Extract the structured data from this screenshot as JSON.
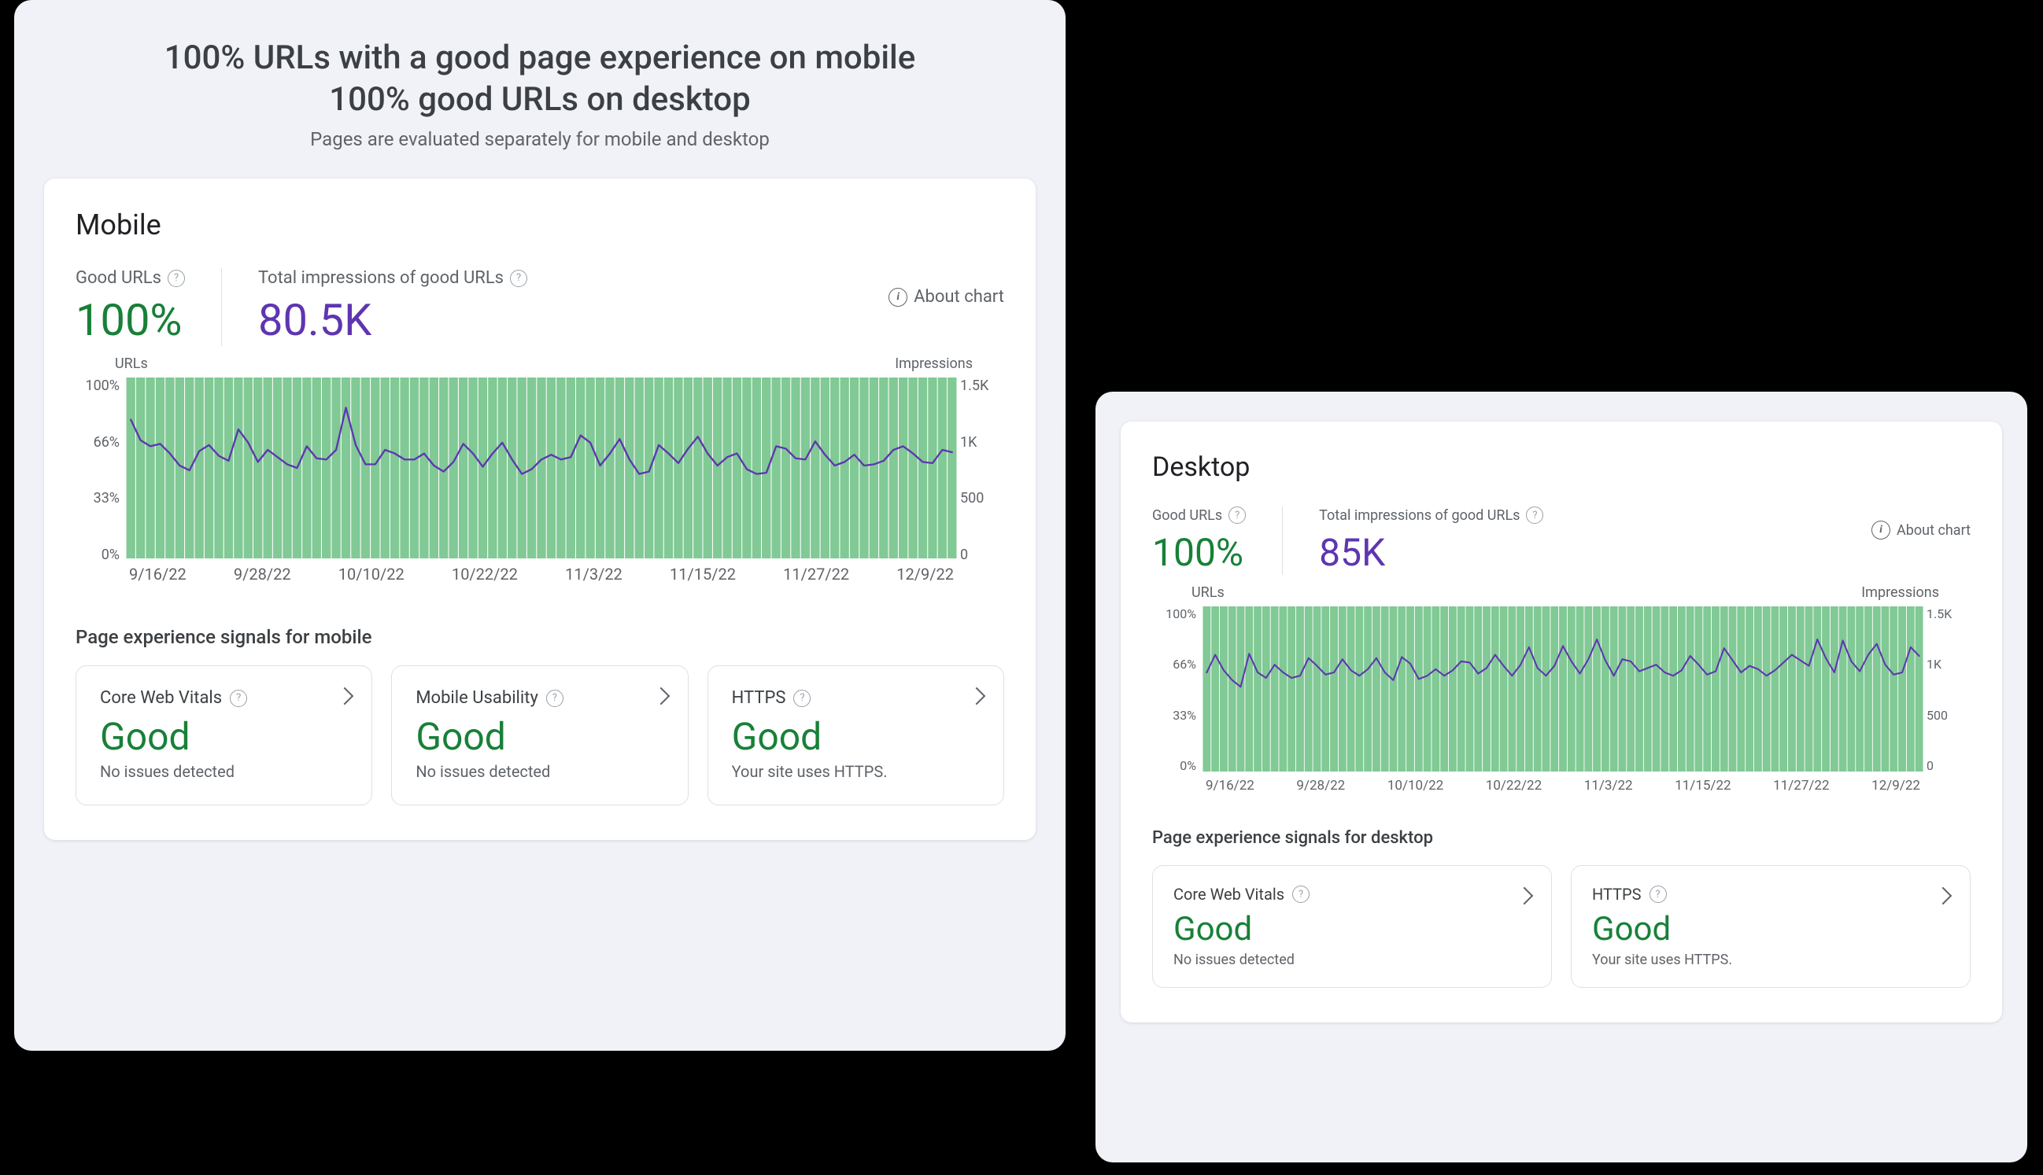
{
  "header": {
    "line1": "100% URLs with a good page experience on mobile",
    "line2": "100% good URLs on desktop",
    "sub": "Pages are evaluated separately for mobile and desktop"
  },
  "about_chart_label": "About chart",
  "mobile": {
    "title": "Mobile",
    "good_urls_label": "Good URLs",
    "good_urls_value": "100%",
    "impr_label": "Total impressions of good URLs",
    "impr_value": "80.5K",
    "signals_title": "Page experience signals for mobile",
    "signals": [
      {
        "name": "Core Web Vitals",
        "status": "Good",
        "sub": "No issues detected"
      },
      {
        "name": "Mobile Usability",
        "status": "Good",
        "sub": "No issues detected"
      },
      {
        "name": "HTTPS",
        "status": "Good",
        "sub": "Your site uses HTTPS."
      }
    ]
  },
  "desktop": {
    "title": "Desktop",
    "good_urls_label": "Good URLs",
    "good_urls_value": "100%",
    "impr_label": "Total impressions of good URLs",
    "impr_value": "85K",
    "signals_title": "Page experience signals for desktop",
    "signals": [
      {
        "name": "Core Web Vitals",
        "status": "Good",
        "sub": "No issues detected"
      },
      {
        "name": "HTTPS",
        "status": "Good",
        "sub": "Your site uses HTTPS."
      }
    ]
  },
  "chart_axis": {
    "left_title": "URLs",
    "right_title": "Impressions",
    "left_ticks": [
      "100%",
      "66%",
      "33%",
      "0%"
    ],
    "right_ticks": [
      "1.5K",
      "1K",
      "500",
      "0"
    ],
    "x_ticks": [
      "9/16/22",
      "9/28/22",
      "10/10/22",
      "10/22/22",
      "11/3/22",
      "11/15/22",
      "11/27/22",
      "12/9/22"
    ]
  },
  "chart_data": [
    {
      "id": "mobile",
      "type": "bar+line",
      "xlabel": "",
      "ylabel_left": "URLs",
      "ylabel_right": "Impressions",
      "x_domain": [
        "9/16/22",
        "12/9/22"
      ],
      "y_left_lim": [
        0,
        100
      ],
      "y_right_lim": [
        0,
        1500
      ],
      "series": [
        {
          "name": "Good URLs %",
          "axis": "left",
          "kind": "bar",
          "color": "#81c995",
          "values": [
            100,
            100,
            100,
            100,
            100,
            100,
            100,
            100,
            100,
            100,
            100,
            100,
            100,
            100,
            100,
            100,
            100,
            100,
            100,
            100,
            100,
            100,
            100,
            100,
            100,
            100,
            100,
            100,
            100,
            100,
            100,
            100,
            100,
            100,
            100,
            100,
            100,
            100,
            100,
            100,
            100,
            100,
            100,
            100,
            100,
            100,
            100,
            100,
            100,
            100,
            100,
            100,
            100,
            100,
            100,
            100,
            100,
            100,
            100,
            100,
            100,
            100,
            100,
            100,
            100,
            100,
            100,
            100,
            100,
            100,
            100,
            100,
            100,
            100,
            100,
            100,
            100,
            100,
            100,
            100,
            100,
            100,
            100,
            100,
            100
          ]
        },
        {
          "name": "Impressions",
          "axis": "right",
          "kind": "line",
          "color": "#5e35b1",
          "values": [
            1150,
            980,
            930,
            950,
            870,
            770,
            730,
            890,
            940,
            850,
            810,
            1070,
            960,
            800,
            900,
            840,
            780,
            750,
            930,
            830,
            820,
            900,
            1250,
            940,
            780,
            780,
            900,
            870,
            820,
            820,
            870,
            770,
            720,
            800,
            950,
            870,
            760,
            870,
            960,
            820,
            700,
            740,
            820,
            860,
            820,
            840,
            1020,
            960,
            770,
            870,
            990,
            820,
            700,
            720,
            940,
            870,
            790,
            910,
            1010,
            870,
            770,
            840,
            870,
            740,
            700,
            710,
            930,
            910,
            830,
            820,
            970,
            860,
            770,
            800,
            860,
            770,
            780,
            810,
            900,
            930,
            870,
            800,
            790,
            900,
            880
          ]
        }
      ]
    },
    {
      "id": "desktop",
      "type": "bar+line",
      "xlabel": "",
      "ylabel_left": "URLs",
      "ylabel_right": "Impressions",
      "x_domain": [
        "9/16/22",
        "12/9/22"
      ],
      "y_left_lim": [
        0,
        100
      ],
      "y_right_lim": [
        0,
        1500
      ],
      "series": [
        {
          "name": "Good URLs %",
          "axis": "left",
          "kind": "bar",
          "color": "#81c995",
          "values": [
            100,
            100,
            100,
            100,
            100,
            100,
            100,
            100,
            100,
            100,
            100,
            100,
            100,
            100,
            100,
            100,
            100,
            100,
            100,
            100,
            100,
            100,
            100,
            100,
            100,
            100,
            100,
            100,
            100,
            100,
            100,
            100,
            100,
            100,
            100,
            100,
            100,
            100,
            100,
            100,
            100,
            100,
            100,
            100,
            100,
            100,
            100,
            100,
            100,
            100,
            100,
            100,
            100,
            100,
            100,
            100,
            100,
            100,
            100,
            100,
            100,
            100,
            100,
            100,
            100,
            100,
            100,
            100,
            100,
            100,
            100,
            100,
            100,
            100,
            100,
            100,
            100,
            100,
            100,
            100,
            100,
            100,
            100,
            100,
            100
          ]
        },
        {
          "name": "Impressions",
          "axis": "right",
          "kind": "line",
          "color": "#5e35b1",
          "values": [
            900,
            1060,
            920,
            830,
            770,
            1070,
            900,
            850,
            970,
            900,
            850,
            870,
            1030,
            960,
            880,
            900,
            1020,
            920,
            870,
            930,
            1030,
            900,
            830,
            1040,
            980,
            840,
            870,
            930,
            870,
            920,
            1000,
            990,
            890,
            940,
            1060,
            960,
            870,
            970,
            1130,
            940,
            870,
            960,
            1140,
            1000,
            890,
            1020,
            1200,
            1010,
            870,
            1020,
            1000,
            910,
            940,
            970,
            900,
            870,
            920,
            1050,
            970,
            880,
            910,
            1120,
            1010,
            900,
            960,
            930,
            870,
            920,
            990,
            1060,
            1010,
            960,
            1200,
            1030,
            900,
            1190,
            1000,
            910,
            1060,
            1160,
            970,
            880,
            900,
            1130,
            1050
          ]
        }
      ]
    }
  ]
}
